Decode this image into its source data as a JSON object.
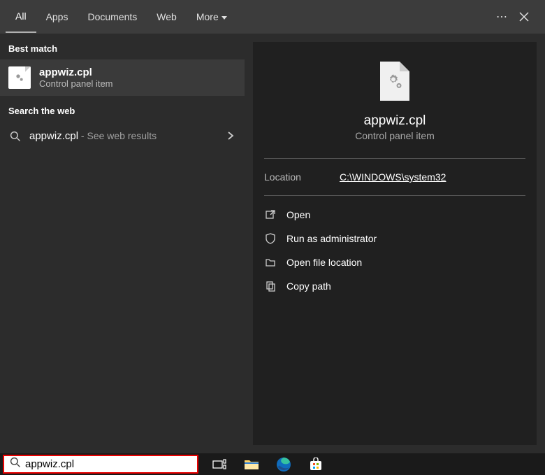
{
  "tabs": {
    "all": "All",
    "apps": "Apps",
    "documents": "Documents",
    "web": "Web",
    "more": "More"
  },
  "left": {
    "best_match_label": "Best match",
    "best_match": {
      "title": "appwiz.cpl",
      "subtitle": "Control panel item"
    },
    "search_web_label": "Search the web",
    "web_result": {
      "term": "appwiz.cpl",
      "suffix": " - See web results"
    }
  },
  "preview": {
    "title": "appwiz.cpl",
    "subtitle": "Control panel item",
    "location_label": "Location",
    "location_value": "C:\\WINDOWS\\system32",
    "actions": {
      "open": "Open",
      "run_admin": "Run as administrator",
      "open_loc": "Open file location",
      "copy_path": "Copy path"
    }
  },
  "search_input": "appwiz.cpl"
}
